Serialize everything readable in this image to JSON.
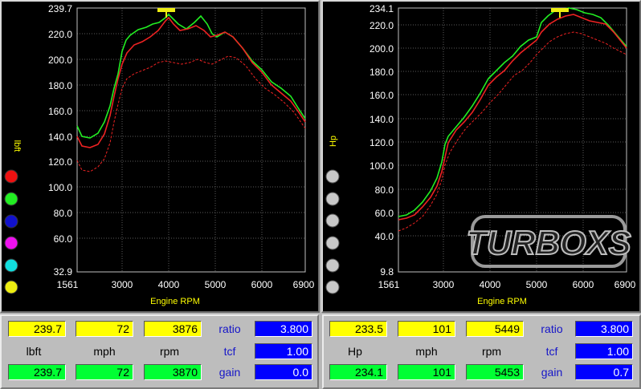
{
  "left": {
    "y_label": "lbft",
    "x_label": "Engine RPM",
    "y_ticks": [
      "239.7",
      "220.0",
      "200.0",
      "180.0",
      "160.0",
      "140.0",
      "120.0",
      "100.0",
      "80.0",
      "60.0",
      "32.9"
    ],
    "x_ticks": [
      "1561",
      "3000",
      "4000",
      "5000",
      "6000",
      "6900"
    ],
    "peak_marker": "239.7",
    "run_colors": [
      "#ee1111",
      "#22ee22",
      "#1111cc",
      "#ee11ee",
      "#11dddd",
      "#eeee11"
    ],
    "readout": {
      "run1": [
        "239.7",
        "72",
        "3876"
      ],
      "units": [
        "lbft",
        "mph",
        "rpm"
      ],
      "run2": [
        "239.7",
        "72",
        "3870"
      ],
      "ratio_label": "ratio",
      "ratio": "3.800",
      "tcf_label": "tcf",
      "tcf": "1.00",
      "gain_label": "gain",
      "gain": "0.0"
    }
  },
  "right": {
    "y_label": "Hp",
    "x_label": "Engine RPM",
    "y_ticks": [
      "234.1",
      "220.0",
      "200.0",
      "180.0",
      "160.0",
      "140.0",
      "120.0",
      "100.0",
      "80.0",
      "60.0",
      "40.0",
      "9.8"
    ],
    "x_ticks": [
      "1561",
      "3000",
      "4000",
      "5000",
      "6000",
      "6900"
    ],
    "peak_marker": "234.1",
    "watermark": "TURBOXS",
    "readout": {
      "run1": [
        "233.5",
        "101",
        "5449"
      ],
      "units": [
        "Hp",
        "mph",
        "rpm"
      ],
      "run2": [
        "234.1",
        "101",
        "5453"
      ],
      "ratio_label": "ratio",
      "ratio": "3.800",
      "tcf_label": "tcf",
      "tcf": "1.00",
      "gain_label": "gain",
      "gain": "0.7"
    }
  },
  "colors": {
    "run_green": "#22ee22",
    "run_red": "#ee2222",
    "axis": "#c0c0c0",
    "tick_text": "#ffffff",
    "label_text": "#ffff00"
  }
}
